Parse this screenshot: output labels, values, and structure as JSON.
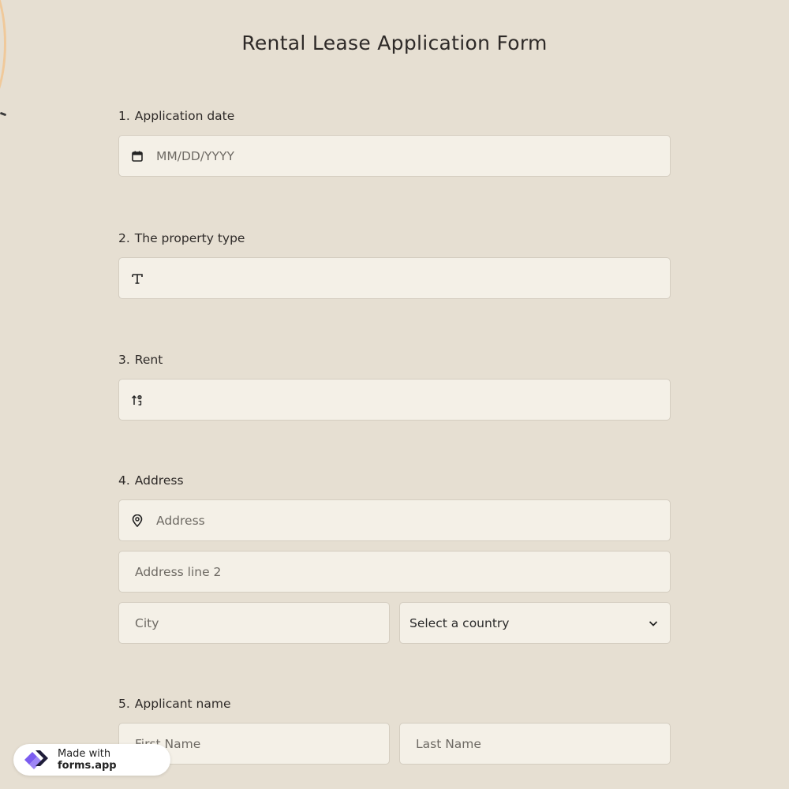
{
  "form": {
    "title": "Rental Lease Application Form"
  },
  "questions": [
    {
      "number": "1.",
      "label": "Application date",
      "placeholder": "MM/DD/YYYY",
      "icon": "calendar-icon"
    },
    {
      "number": "2.",
      "label": "The property type",
      "placeholder": "",
      "icon": "text-icon"
    },
    {
      "number": "3.",
      "label": "Rent",
      "placeholder": "",
      "icon": "number-sort-icon"
    },
    {
      "number": "4.",
      "label": "Address",
      "icon": "location-pin-icon",
      "address_placeholder": "Address",
      "address_line2_placeholder": "Address line 2",
      "city_placeholder": "City",
      "country_select": "Select a country"
    },
    {
      "number": "5.",
      "label": "Applicant name",
      "first_name_placeholder": "First Name",
      "last_name_placeholder": "Last Name"
    }
  ],
  "badge": {
    "made_with": "Made with",
    "brand": "forms.app"
  },
  "colors": {
    "background": "#e6dfd2",
    "field_background": "#f4f0e7",
    "field_border": "#d4cdc0",
    "text": "#2e2a28",
    "logo_purple": "#7b5cf0",
    "logo_dark": "#1f1d3a",
    "deco_orange": "#f0c99a"
  }
}
